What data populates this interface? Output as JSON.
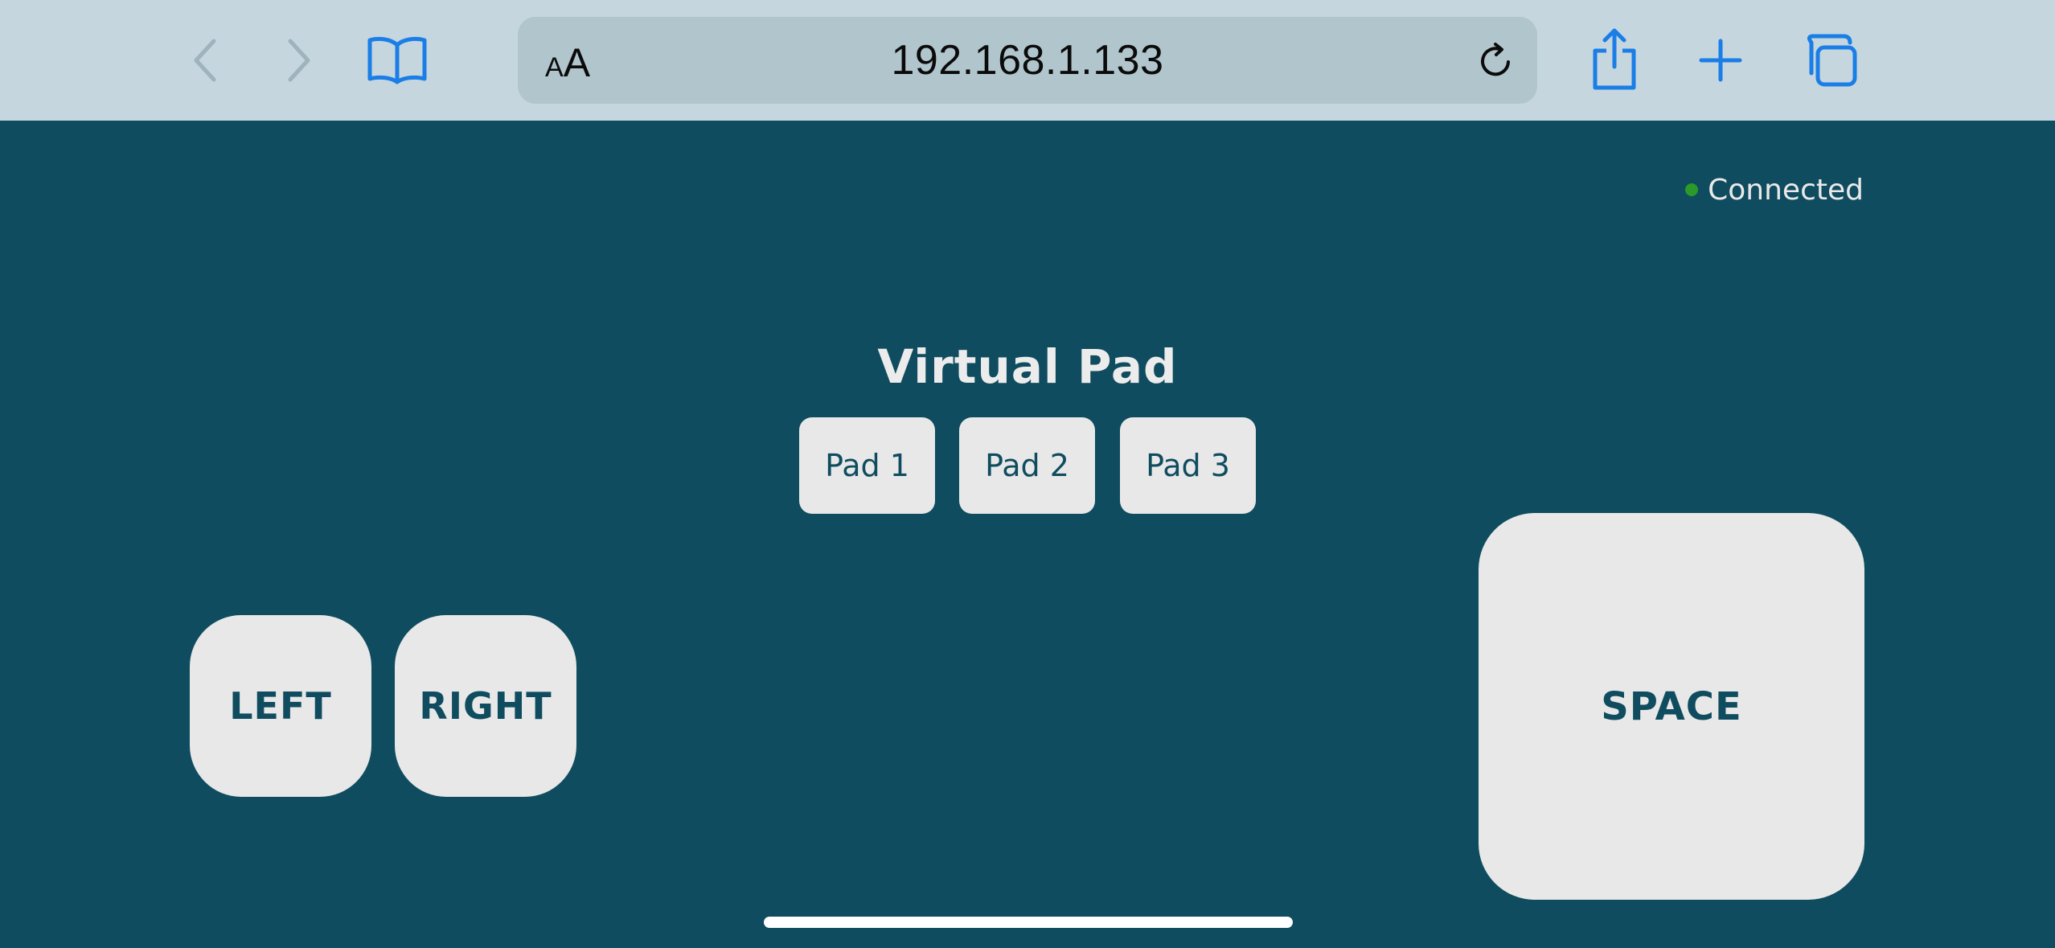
{
  "browser": {
    "aa_small": "A",
    "aa_big": "A",
    "url": "192.168.1.133",
    "icons": {
      "back": "chevron-left-icon",
      "forward": "chevron-right-icon",
      "bookmarks": "book-icon",
      "reload": "reload-icon",
      "share": "share-icon",
      "new_tab": "plus-icon",
      "tabs": "tabs-icon"
    },
    "accent_color": "#1a7ee6"
  },
  "page": {
    "background_color": "#0f4c5f",
    "status": {
      "label": "Connected",
      "dot_color": "#2b9a28"
    },
    "title": "Virtual Pad",
    "pads": [
      {
        "label": "Pad 1"
      },
      {
        "label": "Pad 2"
      },
      {
        "label": "Pad 3"
      }
    ],
    "controls": {
      "left": "LEFT",
      "right": "RIGHT",
      "space": "SPACE"
    }
  }
}
